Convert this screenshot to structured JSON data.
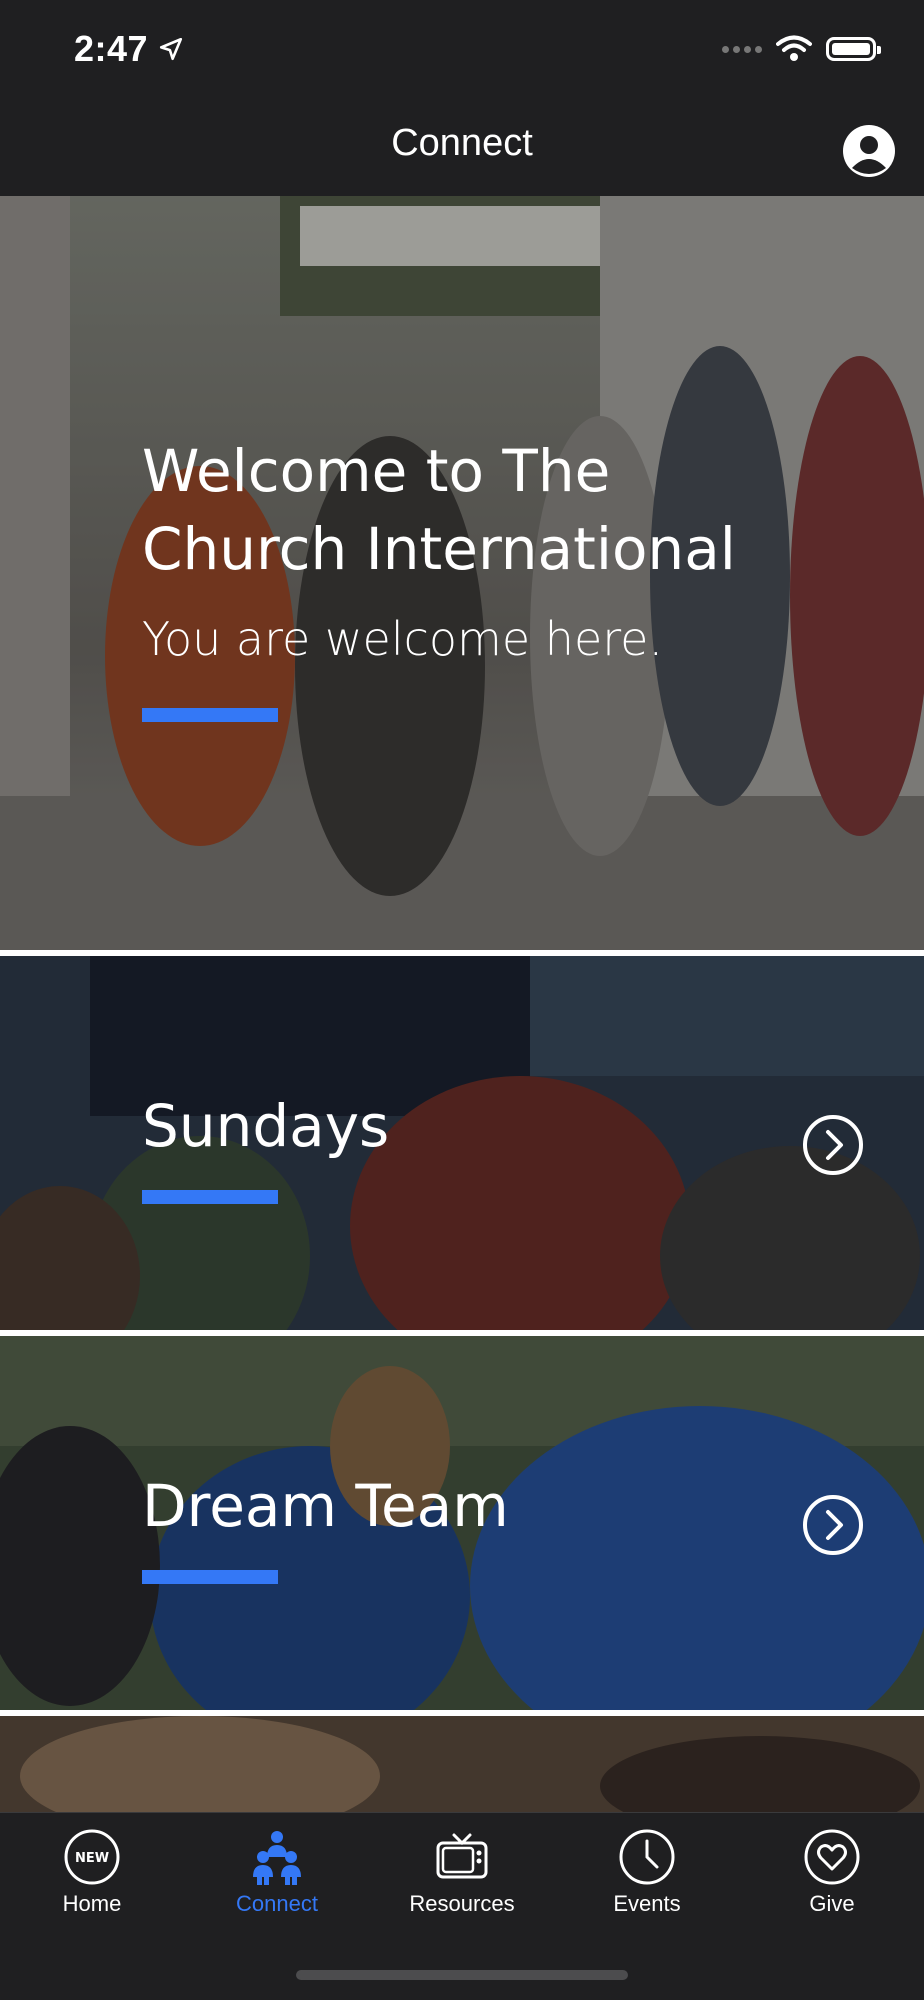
{
  "status": {
    "time": "2:47"
  },
  "nav": {
    "title": "Connect",
    "profile_icon": "person-circle-icon"
  },
  "hero": {
    "title_line1": "Welcome to The",
    "title_line2": "Church International",
    "subtitle": "You are welcome here.",
    "accent_color": "#3478f6"
  },
  "cards": [
    {
      "label": "Sundays",
      "icon": "chevron-right-circle-icon"
    },
    {
      "label": "Dream Team",
      "icon": "chevron-right-circle-icon"
    }
  ],
  "tabs": [
    {
      "label": "Home",
      "icon": "new-badge-icon",
      "active": false
    },
    {
      "label": "Connect",
      "icon": "people-group-icon",
      "active": true
    },
    {
      "label": "Resources",
      "icon": "tv-icon",
      "active": false
    },
    {
      "label": "Events",
      "icon": "clock-icon",
      "active": false
    },
    {
      "label": "Give",
      "icon": "heart-icon",
      "active": false
    }
  ],
  "colors": {
    "bar_background": "#1f1f21",
    "active_tab": "#3478f6"
  }
}
